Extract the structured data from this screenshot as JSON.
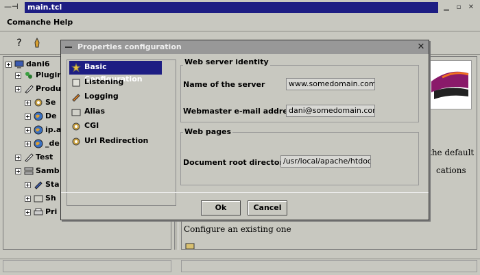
{
  "window": {
    "title": "main.tcl",
    "pin_glyph": "—⊣"
  },
  "menu": {
    "items": [
      "Comanche",
      "Help"
    ]
  },
  "toolbar": {
    "icons": [
      "help-icon",
      "save-icon",
      "back-icon"
    ]
  },
  "tree": {
    "items": [
      {
        "label": "dani6",
        "icon": "computer-icon",
        "indent": 0
      },
      {
        "label": "Plugins",
        "icon": "plugin-icon",
        "indent": 1
      },
      {
        "label": "Produ",
        "icon": "pen-icon",
        "indent": 1
      },
      {
        "label": "Se",
        "icon": "gear-icon",
        "indent": 2
      },
      {
        "label": "De",
        "icon": "globe-icon",
        "indent": 2
      },
      {
        "label": "ip.a",
        "icon": "globe-icon",
        "indent": 2
      },
      {
        "label": "_de",
        "icon": "globe-icon",
        "indent": 2
      },
      {
        "label": "Test",
        "icon": "pen-icon",
        "indent": 1
      },
      {
        "label": "Samb",
        "icon": "network-icon",
        "indent": 1
      },
      {
        "label": "Sta",
        "icon": "edit-icon",
        "indent": 2
      },
      {
        "label": "Sh",
        "icon": "folder-icon",
        "indent": 2
      },
      {
        "label": "Pri",
        "icon": "printer-icon",
        "indent": 2
      }
    ]
  },
  "content": {
    "snippet_1": "the default",
    "snippet_2": "cations",
    "configure_text": "Configure an existing one"
  },
  "dialog": {
    "title": "Properties configuration",
    "close_glyph": "✕",
    "categories": [
      {
        "label": "Basic Configuration",
        "selected": true
      },
      {
        "label": "Listening",
        "selected": false
      },
      {
        "label": "Logging",
        "selected": false
      },
      {
        "label": "Alias",
        "selected": false
      },
      {
        "label": "CGI",
        "selected": false
      },
      {
        "label": "Url Redirection",
        "selected": false
      }
    ],
    "identity_group": {
      "title": "Web server identity",
      "server_name_label": "Name of the server",
      "server_name_value": "www.somedomain.com",
      "email_label": "Webmaster e-mail address",
      "email_value": "dani@somedomain.com"
    },
    "pages_group": {
      "title": "Web pages",
      "docroot_label": "Document root directory",
      "docroot_value": "/usr/local/apache/htdocs'"
    },
    "buttons": {
      "ok": "Ok",
      "cancel": "Cancel"
    }
  },
  "colors": {
    "title_active": "#1d1d83",
    "title_inactive": "#989898",
    "background": "#c8c8c0",
    "selection": "#1d1d83"
  }
}
